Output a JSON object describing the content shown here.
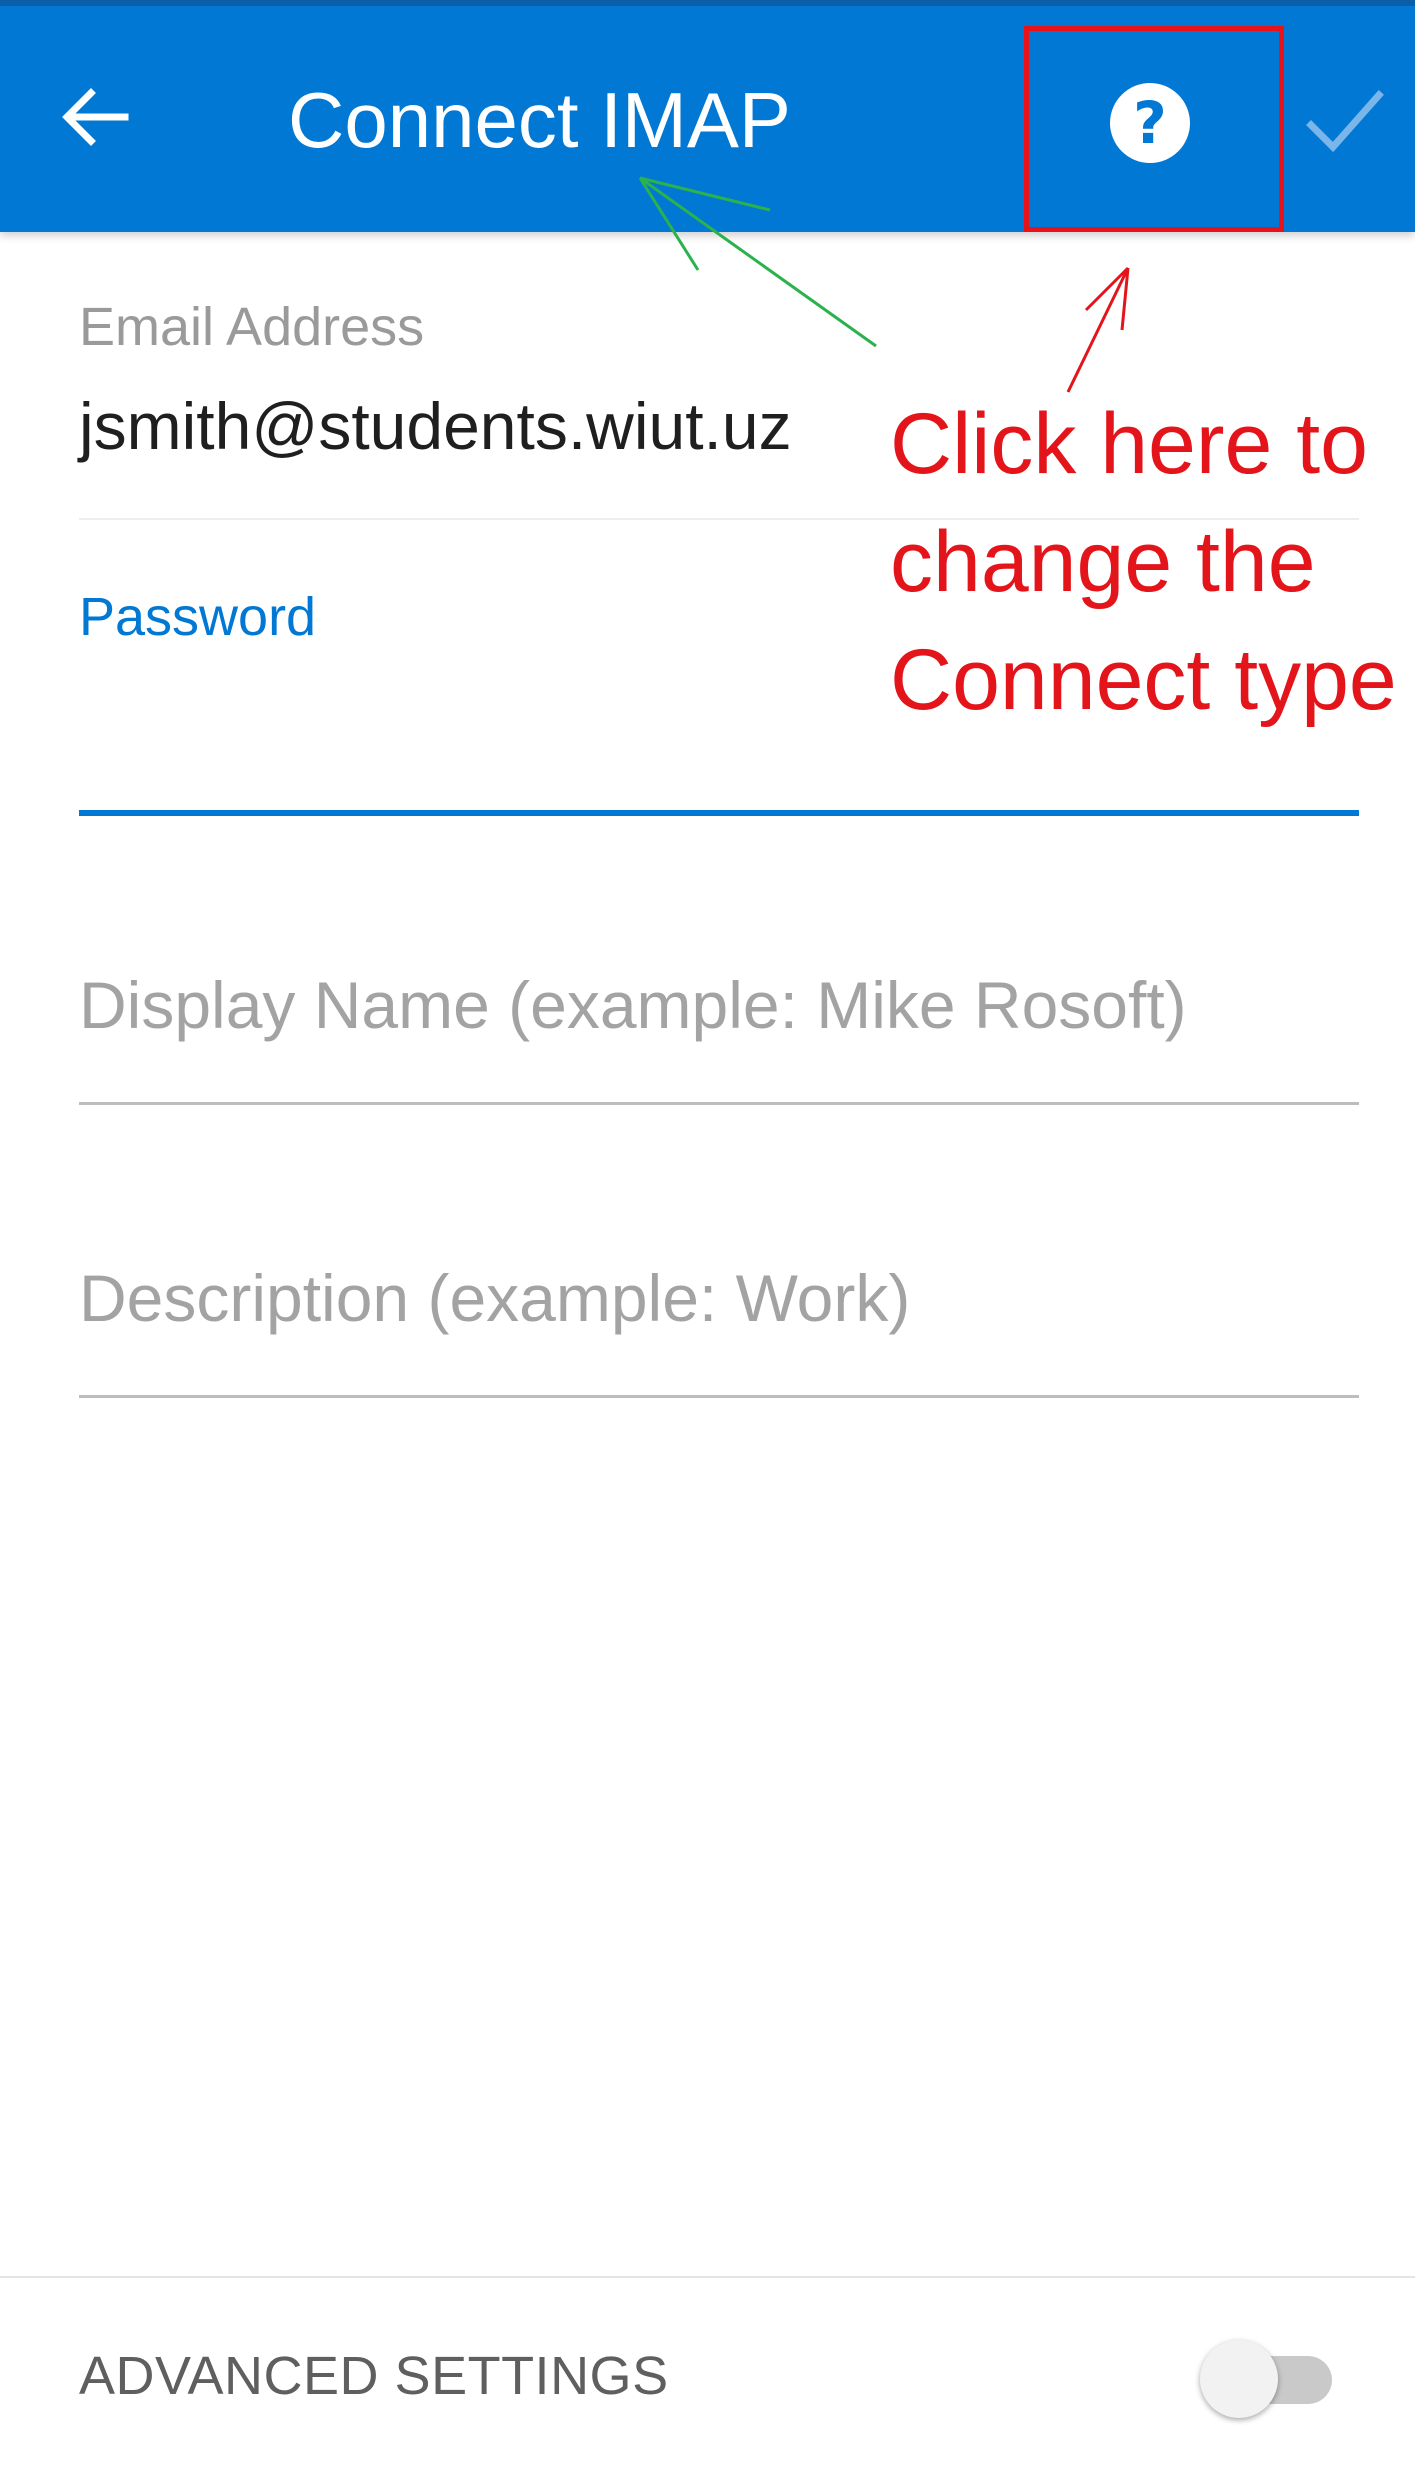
{
  "header": {
    "title": "Connect IMAP",
    "back_icon": "arrow-left-icon",
    "help_icon": "question-circle-icon",
    "help_glyph": "?",
    "confirm_icon": "checkmark-icon",
    "background_color": "#0078d4"
  },
  "form": {
    "email": {
      "label": "Email Address",
      "value": "jsmith@students.wiut.uz"
    },
    "password": {
      "label": "Password",
      "value": "",
      "focused": true,
      "accent_color": "#0078d4"
    },
    "display_name": {
      "placeholder": "Display Name (example: Mike Rosoft)"
    },
    "description": {
      "placeholder": "Description (example: Work)"
    }
  },
  "advanced": {
    "label": "ADVANCED SETTINGS",
    "enabled": false
  },
  "annotation": {
    "lines": [
      "Click here to",
      "change the",
      "Connect type"
    ],
    "color": "#e3151b",
    "arrow_color_title": "#2bb24c",
    "arrow_color_help": "#e3151b"
  }
}
